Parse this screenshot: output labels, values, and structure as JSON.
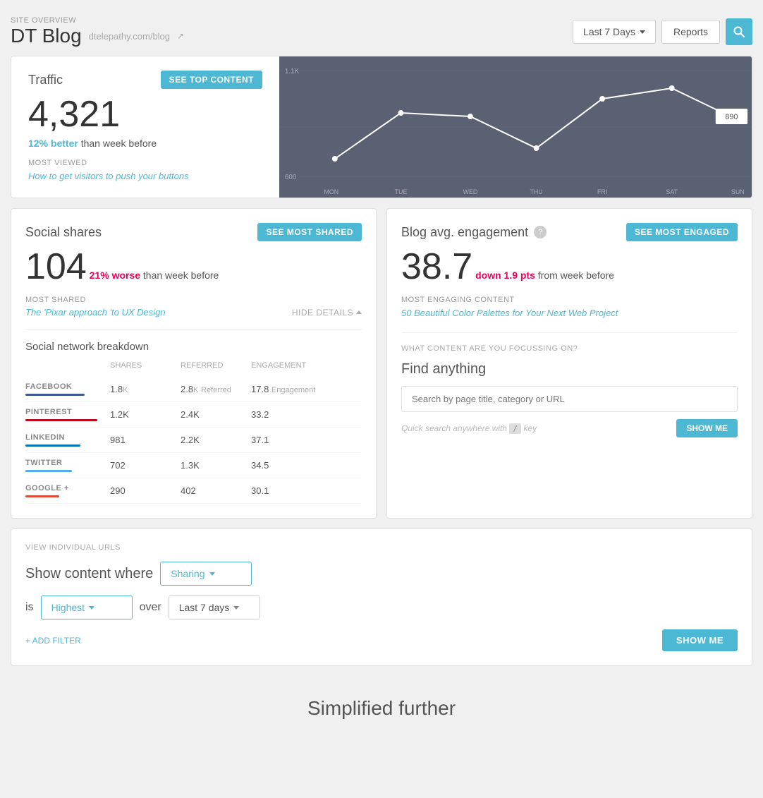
{
  "header": {
    "site_overview_label": "SITE OVERVIEW",
    "site_title": "DT Blog",
    "site_url": "dtelepathy.com/blog",
    "external_link_symbol": "↗",
    "date_range_label": "Last 7 Days",
    "reports_label": "Reports",
    "search_icon": "🔍"
  },
  "traffic": {
    "title": "Traffic",
    "see_top_btn": "SEE TOP CONTENT",
    "number": "4,321",
    "comparison_colored": "12% better",
    "comparison_rest": " than week before",
    "most_viewed_label": "MOST VIEWED",
    "most_viewed_link": "How to get visitors to push your buttons",
    "chart": {
      "y_top": "1.1K",
      "y_bottom": "600",
      "last_value": "890",
      "days": [
        "MON",
        "TUE",
        "WED",
        "THU",
        "FRI",
        "SAT",
        "SUN"
      ]
    }
  },
  "social_shares": {
    "title": "Social shares",
    "see_most_btn": "SEE MOST SHARED",
    "number": "104",
    "comparison_colored": "21% worse",
    "comparison_rest": " than week before",
    "most_shared_label": "MOST SHARED",
    "most_shared_link": "The 'Pixar approach 'to UX Design",
    "hide_details": "HIDE DETAILS",
    "breakdown_title": "Social network breakdown",
    "breakdown_headers": [
      "",
      "Shares",
      "Referred",
      "Engagement"
    ],
    "networks": [
      {
        "name": "FACEBOOK",
        "shares": "1.8K",
        "referred": "2.8K",
        "engagement": "17.8",
        "bar_class": "bar-facebook"
      },
      {
        "name": "PINTEREST",
        "shares": "1.2K",
        "referred": "2.4K",
        "engagement": "33.2",
        "bar_class": "bar-pinterest"
      },
      {
        "name": "LINKEDIN",
        "shares": "981",
        "referred": "2.2K",
        "engagement": "37.1",
        "bar_class": "bar-linkedin"
      },
      {
        "name": "TWITTER",
        "shares": "702",
        "referred": "1.3K",
        "engagement": "34.5",
        "bar_class": "bar-twitter"
      },
      {
        "name": "GOOGLE +",
        "shares": "290",
        "referred": "402",
        "engagement": "30.1",
        "bar_class": "bar-google"
      }
    ]
  },
  "engagement": {
    "title": "Blog avg. engagement",
    "see_most_btn": "SEE MOST ENGAGED",
    "help_icon": "?",
    "number": "38.7",
    "down_label": "down 1.9 pts",
    "comparison_rest": " from week before",
    "most_engaging_label": "MOST ENGAGING CONTENT",
    "most_engaging_link": "50 Beautiful Color Palettes for Your Next Web Project",
    "focussing_label": "WHAT CONTENT ARE YOU FOCUSSING ON?",
    "find_title": "Find anything",
    "search_placeholder": "Search by page title, category or URL",
    "quick_hint_pre": "Quick search anywhere with",
    "kbd": "/",
    "key_label": "key",
    "show_me_btn": "SHOW ME"
  },
  "view_urls": {
    "label": "VIEW INDIVIDUAL URLS",
    "show_content_text": "Show content where",
    "sharing_dropdown": "Sharing",
    "is_text": "is",
    "highest_dropdown": "Highest",
    "over_text": "over",
    "last7_dropdown": "Last 7 days",
    "add_filter_label": "+ ADD FILTER",
    "show_me_btn": "SHOW ME"
  },
  "footer": {
    "text": "Simplified further"
  }
}
